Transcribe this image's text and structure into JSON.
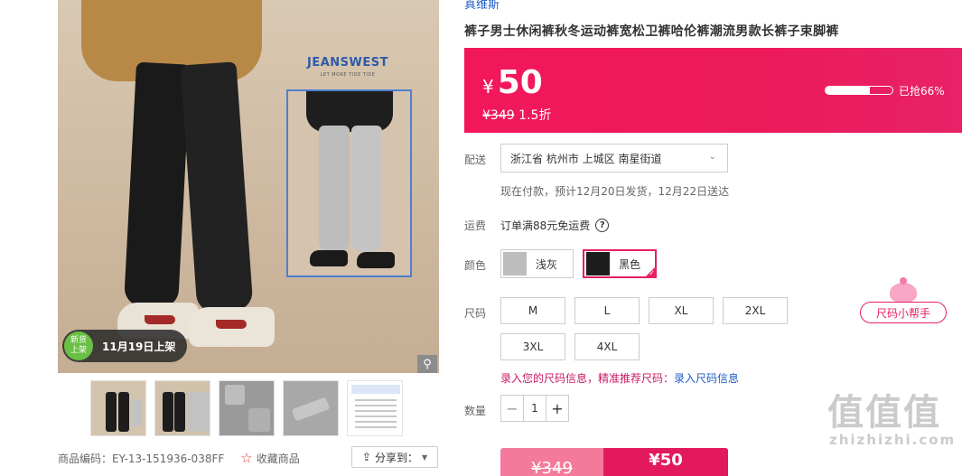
{
  "gallery": {
    "brand_logo": "JEANSWEST",
    "brand_tagline": "LET MORE TIDE TIDE",
    "badge_icon_text": "新货\n上架",
    "badge_text": "11月19日上架",
    "zoom_icon": "magnifier-icon",
    "thumbnails": [
      "黑色-正面",
      "双色对比",
      "浅灰细节",
      "面料细节",
      "尺码表"
    ]
  },
  "meta": {
    "product_code": "商品编码：EY-13-151936-038FF",
    "favorite_label": "收藏商品",
    "share_label": "分享到："
  },
  "product": {
    "brand": "真维斯",
    "title": "裤子男士休闲裤秋冬运动裤宽松卫裤哈伦裤潮流男款长裤子束脚裤"
  },
  "price": {
    "currency": "¥",
    "current": "50",
    "original": "¥349",
    "discount": "1.5折",
    "sold_progress": 0.66,
    "sold_label": "已抢66%"
  },
  "delivery": {
    "label": "配送",
    "address": "浙江省 杭州市 上城区 南星街道",
    "note": "现在付款，预计12月20日发货，12月22日送达"
  },
  "freight": {
    "label": "运费",
    "text": "订单满88元免运费"
  },
  "color": {
    "label": "颜色",
    "options": [
      {
        "name": "浅灰",
        "swatch": "#bdbdbd",
        "selected": false
      },
      {
        "name": "黑色",
        "swatch": "#1d1d1d",
        "selected": true
      }
    ]
  },
  "size": {
    "label": "尺码",
    "options": [
      "M",
      "L",
      "XL",
      "2XL",
      "3XL",
      "4XL"
    ],
    "helper_label": "尺码小帮手",
    "tip_prefix": "录入您的尺码信息，精准推荐尺码：",
    "tip_link": "录入尺码信息"
  },
  "quantity": {
    "label": "数量",
    "value": "1",
    "minus": "−",
    "plus": "+"
  },
  "buy": {
    "original_price": "¥349",
    "buy_price": "¥50"
  },
  "watermark": {
    "big": "值值值",
    "small": "zhizhizhi.com"
  },
  "colors": {
    "accent": "#ec1a5b",
    "link": "#1f5bc5",
    "tip": "#c81a64"
  }
}
